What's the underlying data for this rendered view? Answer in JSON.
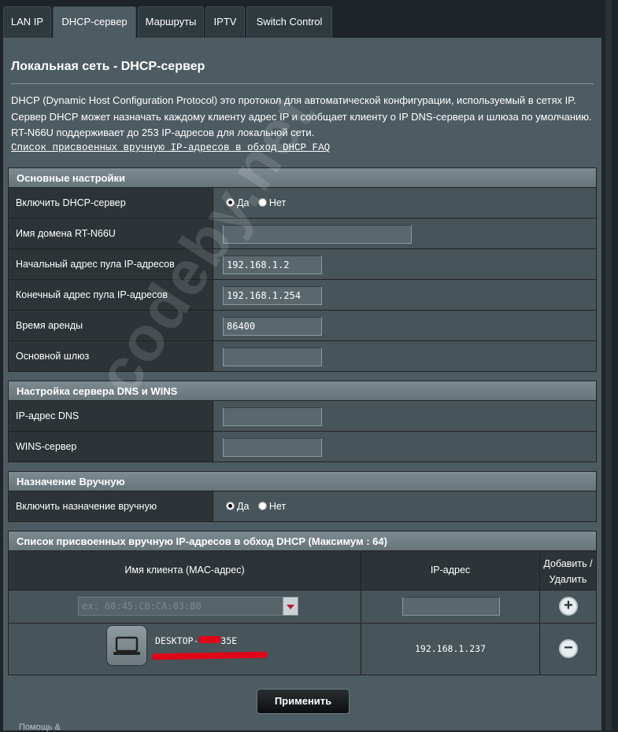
{
  "tabs": [
    {
      "label": "LAN IP",
      "active": false
    },
    {
      "label": "DHCP-сервер",
      "active": true
    },
    {
      "label": "Маршруты",
      "active": false
    },
    {
      "label": "IPTV",
      "active": false
    },
    {
      "label": "Switch Control",
      "active": false
    }
  ],
  "page": {
    "title": "Локальная сеть - DHCP-сервер",
    "description": "DHCP (Dynamic Host Configuration Protocol) это протокол для автоматической конфигурации, используемый в сетях IP. Сервер DHCP может назначать каждому клиенту адрес IP и сообщает клиенту о IP DNS-сервера и шлюза по умолчанию. RT-N66U поддерживает до 253 IP-адресов для локальной сети.",
    "faq_link": "Список присвоенных вручную IP-адресов в обход DHCP FAQ"
  },
  "basic": {
    "header": "Основные настройки",
    "enable_dhcp": {
      "label": "Включить DHCP-сервер",
      "yes": "Да",
      "no": "Нет",
      "selected": "yes"
    },
    "domain": {
      "label": "Имя домена RT-N66U",
      "value": ""
    },
    "pool_start": {
      "label": "Начальный адрес пула IP-адресов",
      "value": "192.168.1.2"
    },
    "pool_end": {
      "label": "Конечный адрес пула IP-адресов",
      "value": "192.168.1.254"
    },
    "lease": {
      "label": "Время аренды",
      "value": "86400"
    },
    "gateway": {
      "label": "Основной шлюз",
      "value": ""
    }
  },
  "dns": {
    "header": "Настройка сервера DNS и WINS",
    "dns_ip": {
      "label": "IP-адрес DNS",
      "value": ""
    },
    "wins": {
      "label": "WINS-сервер",
      "value": ""
    }
  },
  "manual": {
    "header": "Назначение Вручную",
    "enable": {
      "label": "Включить назначение вручную",
      "yes": "Да",
      "no": "Нет",
      "selected": "yes"
    }
  },
  "list": {
    "header": "Список присвоенных вручную IP-адресов в обход DHCP (Максимум : 64)",
    "col_client": "Имя клиента (MAC-адрес)",
    "col_ip": "IP-адрес",
    "col_action_1": "Добавить /",
    "col_action_2": "Удалить",
    "mac_placeholder": "ex: 60:45:CB:CA:03:B0",
    "ip_placeholder": "",
    "entries": [
      {
        "client": "DESKTOP-",
        "client_tail": "35E",
        "ip": "192.168.1.237"
      }
    ]
  },
  "apply_label": "Применить",
  "watermark": "codeby.net",
  "footer_help": "Помощь &"
}
